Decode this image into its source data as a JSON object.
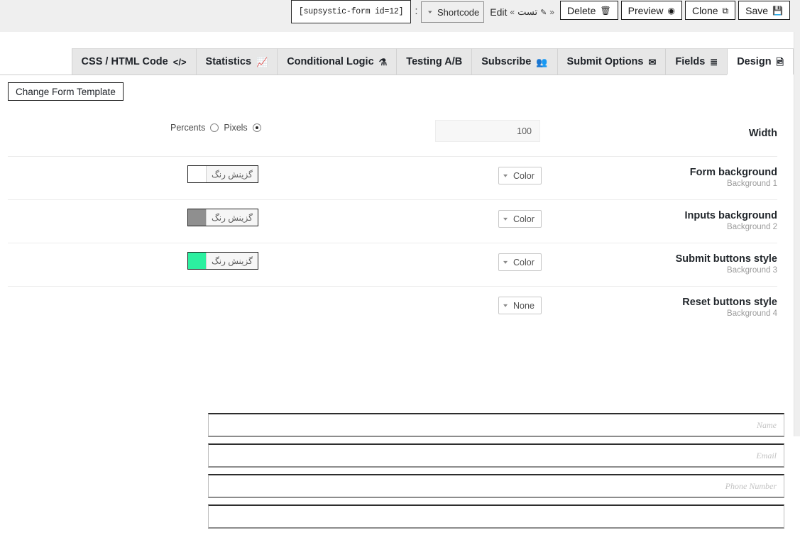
{
  "topbar": {
    "shortcode": "[supsystic-form id=12]",
    "colon": ":",
    "shortcode_select": {
      "label": "Shortcode",
      "caret": "▾"
    },
    "edit": {
      "left_chevron": "«",
      "right_chevron": "»",
      "pencil_icon": "✎",
      "form_name": "تست",
      "edit_label": "Edit"
    },
    "buttons": [
      {
        "label": "Delete",
        "icon": "🗑",
        "name": "delete-button"
      },
      {
        "label": "Preview",
        "icon": "◉",
        "name": "preview-button"
      },
      {
        "label": "Clone",
        "icon": "⧉",
        "name": "clone-button"
      },
      {
        "label": "Save",
        "icon": "💾",
        "name": "save-button"
      }
    ]
  },
  "tabs": [
    {
      "label": "CSS / HTML Code",
      "icon": "</>",
      "active": false
    },
    {
      "label": "Statistics",
      "icon": "📈",
      "active": false
    },
    {
      "label": "Conditional Logic",
      "icon": "⚗",
      "active": false
    },
    {
      "label": "Testing A/B",
      "icon": "",
      "active": false
    },
    {
      "label": "Subscribe",
      "icon": "👥",
      "active": false
    },
    {
      "label": "Submit Options",
      "icon": "✉",
      "active": false
    },
    {
      "label": "Fields",
      "icon": "≣",
      "active": false
    },
    {
      "label": "Design",
      "icon": "🖻",
      "active": true
    }
  ],
  "panel": {
    "change_template_label": "Change Form Template",
    "width_row": {
      "label": "Width",
      "value": "100",
      "placeholder": "100",
      "units": [
        {
          "label": "Percents",
          "selected": false
        },
        {
          "label": "Pixels",
          "selected": true
        }
      ]
    },
    "color_picker_label": "گزینش رنگ",
    "rows": [
      {
        "label": "Form background",
        "sublabel": "Background 1",
        "dropdown": "Color",
        "swatch": "#ffffff",
        "has_picker": true,
        "name": "form-background"
      },
      {
        "label": "Inputs background",
        "sublabel": "Background 2",
        "dropdown": "Color",
        "swatch": "#8f8f8f",
        "has_picker": true,
        "name": "inputs-background"
      },
      {
        "label": "Submit buttons style",
        "sublabel": "Background 3",
        "dropdown": "Color",
        "swatch": "#2cf0a0",
        "has_picker": true,
        "name": "submit-buttons-style"
      },
      {
        "label": "Reset buttons style",
        "sublabel": "Background 4",
        "dropdown": "None",
        "swatch": "",
        "has_picker": false,
        "name": "reset-buttons-style"
      }
    ]
  },
  "preview": {
    "fields": [
      {
        "placeholder": "Name",
        "name": "preview-name-field"
      },
      {
        "placeholder": "Email",
        "name": "preview-email-field"
      },
      {
        "placeholder": "Phone Number",
        "name": "preview-phone-field"
      },
      {
        "placeholder": "",
        "name": "preview-extra-field"
      }
    ]
  },
  "colors": {
    "topbar_bg": "#efefef",
    "tab_bg": "#e7e7e7",
    "tab_active_bg": "#ffffff",
    "divider": "#ececec",
    "sublabel_text": "#9b9b9b",
    "accent_swatch": "#2cf0a0"
  }
}
